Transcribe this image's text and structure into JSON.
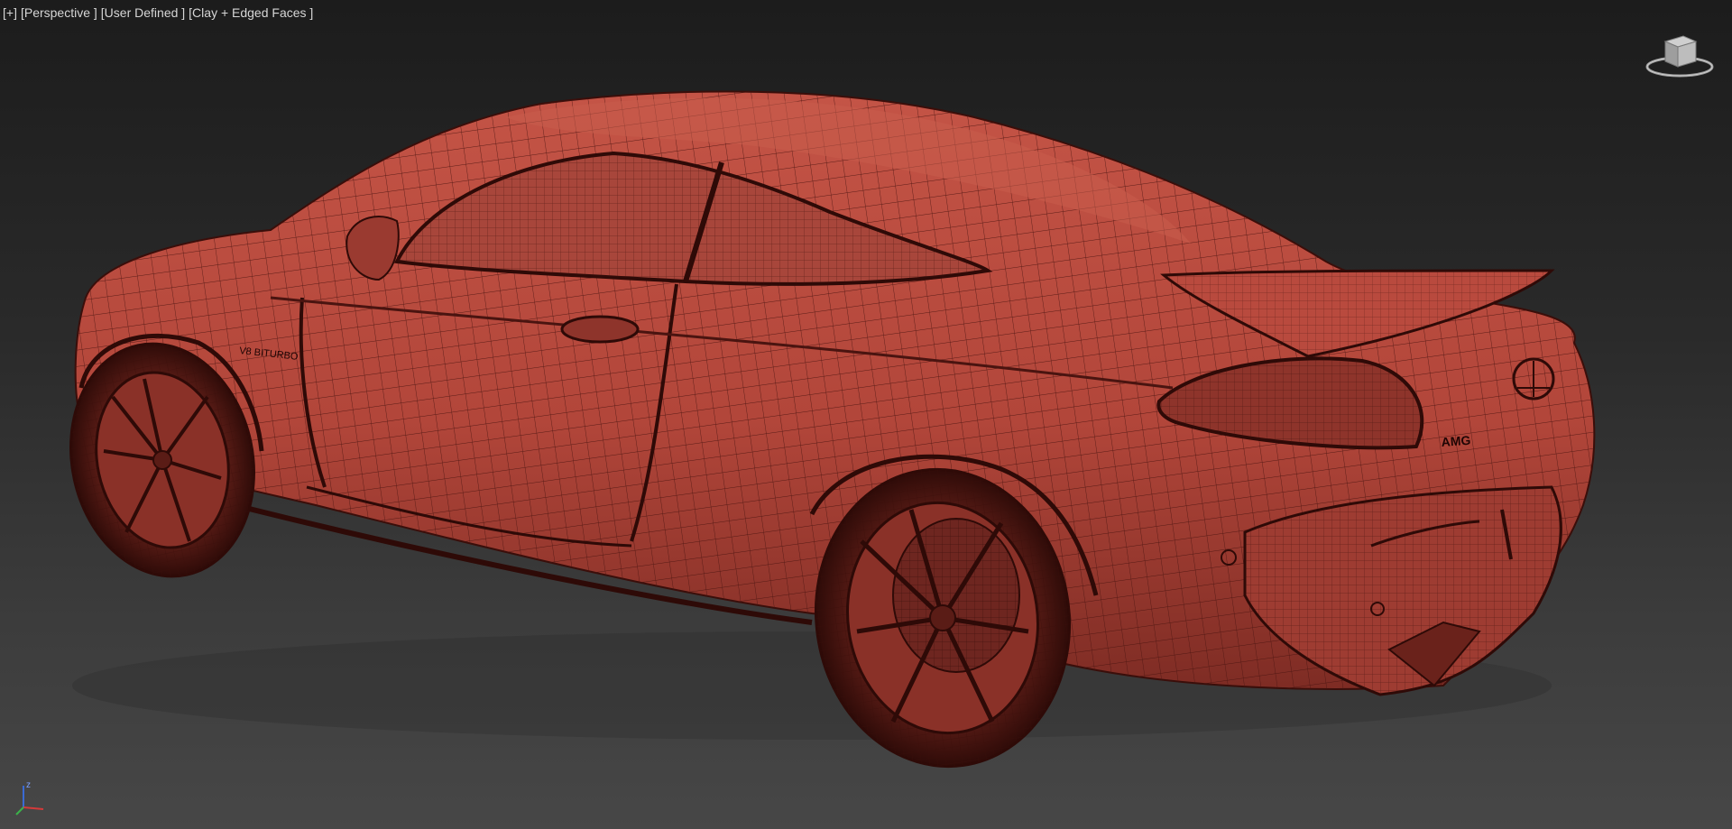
{
  "viewport": {
    "label_segments": [
      "[+]",
      "[Perspective ]",
      "[User Defined ]",
      "[Clay + Edged Faces ]"
    ],
    "shading_mode": "Clay + Edged Faces",
    "projection": "Perspective"
  },
  "scene": {
    "object": "car-wireframe-model",
    "badge_text": "AMG",
    "side_badge_text": "V8 BITURBO"
  },
  "axis_tripod": {
    "z_label": "z",
    "x_color": "#d43a3a",
    "y_color": "#3ab24a",
    "z_color": "#3a6ad4"
  },
  "colors": {
    "clay": "#b94a3e",
    "clay_dark": "#7a2a22",
    "edge": "#3a0e0a",
    "bg_top": "#1c1c1c",
    "bg_bottom": "#474747"
  }
}
